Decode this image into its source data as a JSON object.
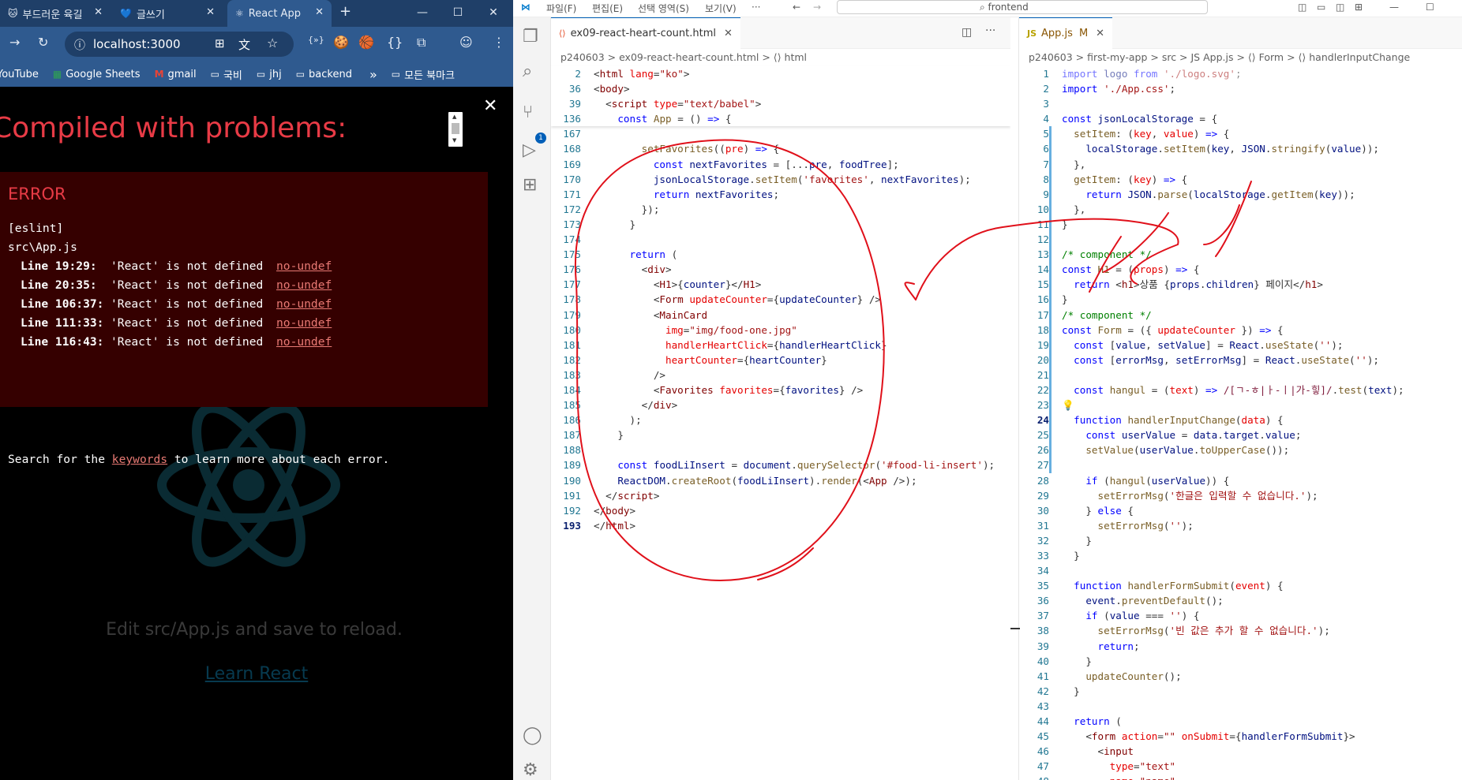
{
  "browser": {
    "tabs": [
      {
        "label": "부드러운 육길",
        "icon": "🐱"
      },
      {
        "label": "글쓰기",
        "icon": "💙"
      },
      {
        "label": "React App",
        "icon": "⚛"
      }
    ],
    "url": "localhost:3000",
    "bookmarks": [
      {
        "label": "YouTube",
        "icon": "▶"
      },
      {
        "label": "Google Sheets",
        "icon": "▦"
      },
      {
        "label": "gmail",
        "icon": "M"
      },
      {
        "label": "국비",
        "icon": "▭"
      },
      {
        "label": "jhj",
        "icon": "▭"
      },
      {
        "label": "backend",
        "icon": "▭"
      }
    ],
    "bookmarks_more": "»",
    "all_bookmarks": "모든 북마크"
  },
  "overlay": {
    "title": "Compiled with problems:",
    "error_label": "ERROR",
    "source": "[eslint]",
    "file": "src\\App.js",
    "errors": [
      {
        "line": "Line 19:29:",
        "message": "'React' is not defined",
        "rule": "no-undef"
      },
      {
        "line": "Line 20:35:",
        "message": "'React' is not defined",
        "rule": "no-undef"
      },
      {
        "line": "Line 106:37:",
        "message": "'React' is not defined",
        "rule": "no-undef"
      },
      {
        "line": "Line 111:33:",
        "message": "'React' is not defined",
        "rule": "no-undef"
      },
      {
        "line": "Line 116:43:",
        "message": "'React' is not defined",
        "rule": "no-undef"
      }
    ],
    "search_prefix": "Search for the ",
    "search_keyword": "keywords",
    "search_suffix": " to learn more about each error.",
    "app_edit_text": "Edit src/App.js and save to reload.",
    "app_learn_link": "Learn React"
  },
  "vscode": {
    "menu": [
      "파일(F)",
      "편집(E)",
      "선택 영역(S)",
      "보기(V)",
      "···"
    ],
    "search_text": "frontend",
    "left_editor": {
      "tab": "ex09-react-heart-count.html",
      "breadcrumb": "p240603  >  ex09-react-heart-count.html  >  ⟨⟩ html"
    },
    "right_editor": {
      "tab": "App.js",
      "tab_status": "M",
      "breadcrumb": "p240603  >  first-my-app  >  src  >  JS App.js  >  ⟨⟩ Form  >  ⟨⟩ handlerInputChange"
    }
  }
}
